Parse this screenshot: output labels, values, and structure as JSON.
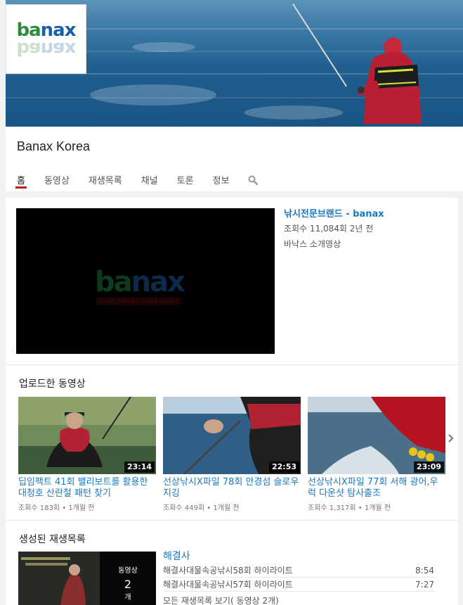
{
  "channel": {
    "name": "Banax Korea",
    "logo": {
      "green": "ba",
      "blue": "nax"
    }
  },
  "tabs": [
    "홈",
    "동영상",
    "재생목록",
    "채널",
    "토론",
    "정보"
  ],
  "featured": {
    "title": "낚시전문브랜드 - banax",
    "meta": "조회수 11,084회  2년 전",
    "description": "바낙스 소개영상",
    "player_logo": {
      "green": "ba",
      "blue": "nax"
    },
    "player_tagline": "TOTAL FISHING ZONE BANAX"
  },
  "uploads": {
    "heading": "업로드한 동영상",
    "videos": [
      {
        "title": "딥임팩트 41회 밸리보트를 활용한 대청호 산란철 패턴 찾기",
        "meta": "조회수 183회 • 1개월 전",
        "duration": "23:14"
      },
      {
        "title": "선상낚시X파일 78회 안경섬 슬로우지깅",
        "meta": "조회수 449회 • 1개월 전",
        "duration": "22:53"
      },
      {
        "title": "선상낚시X파일 77회 서해 광어,우럭 다운샷 탐사출조",
        "meta": "조회수 1,317회 • 1개월 전",
        "duration": "23:09"
      }
    ]
  },
  "playlists": {
    "heading": "생성된 재생목록",
    "thumb_label": "동영상",
    "thumb_count": "2",
    "thumb_unit": "개",
    "title": "해결사",
    "items": [
      {
        "title": "해결사대물속공낚시58회 하이라이트",
        "duration": "8:54"
      },
      {
        "title": "해결사대물속공낚시57회 하이라이트",
        "duration": "7:27"
      }
    ],
    "view_all": "모든 재생목록 보기( 동영상 2개)"
  },
  "colors": {
    "link": "#167ac6",
    "active_tab": "#cc181e",
    "logo_green": "#2e8b3e",
    "logo_blue": "#1b5fa8"
  },
  "icons": {
    "search": "search-icon",
    "next": "chevron-right-icon"
  }
}
